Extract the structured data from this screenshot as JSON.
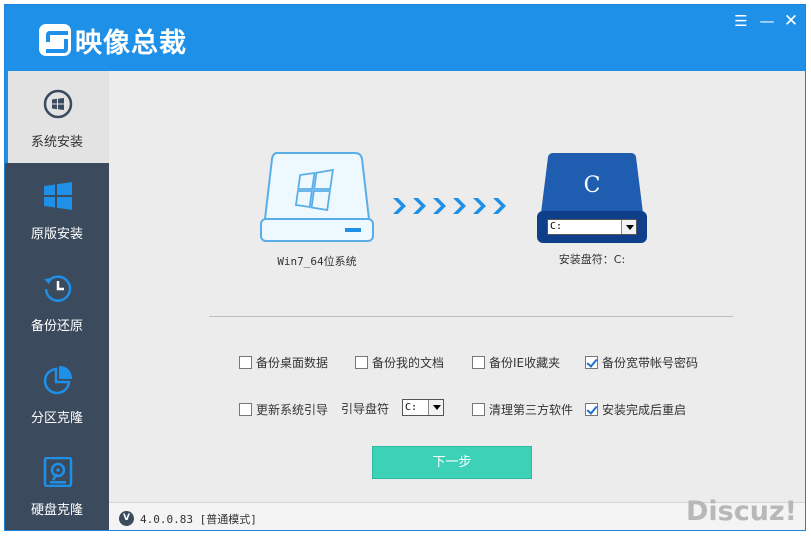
{
  "app": {
    "title": "映像总裁"
  },
  "window_controls": {
    "menu": "☰",
    "minimize": "—",
    "close": "✕"
  },
  "sidebar": {
    "items": [
      {
        "label": "系统安装",
        "icon": "windows-disc-icon",
        "active": true
      },
      {
        "label": "原版安装",
        "icon": "windows-logo-icon",
        "active": false
      },
      {
        "label": "备份还原",
        "icon": "clock-restore-icon",
        "active": false
      },
      {
        "label": "分区克隆",
        "icon": "pie-chart-icon",
        "active": false
      },
      {
        "label": "硬盘克隆",
        "icon": "disk-clone-icon",
        "active": false
      }
    ]
  },
  "main": {
    "source_label": "Win7_64位系统",
    "target": {
      "drive_letter": "C",
      "select_value": "C:",
      "label": "安装盘符：C:"
    },
    "options_row1": [
      {
        "label": "备份桌面数据",
        "checked": false
      },
      {
        "label": "备份我的文档",
        "checked": false
      },
      {
        "label": "备份IE收藏夹",
        "checked": false
      },
      {
        "label": "备份宽带帐号密码",
        "checked": true
      }
    ],
    "options_row2": [
      {
        "label": "更新系统引导",
        "checked": false
      },
      {
        "label": "清理第三方软件",
        "checked": false
      },
      {
        "label": "安装完成后重启",
        "checked": true
      }
    ],
    "boot_drive": {
      "label": "引导盘符",
      "value": "C:"
    },
    "next_button": "下一步"
  },
  "status": {
    "version_icon": "V",
    "version_text": "4.0.0.83 [普通模式]"
  },
  "watermark": "Discuz!",
  "colors": {
    "title_blue": "#1e90e8",
    "sidebar_dark": "#3b4a5c",
    "button_teal": "#3dd1b8",
    "check_blue": "#1e6fd0"
  }
}
